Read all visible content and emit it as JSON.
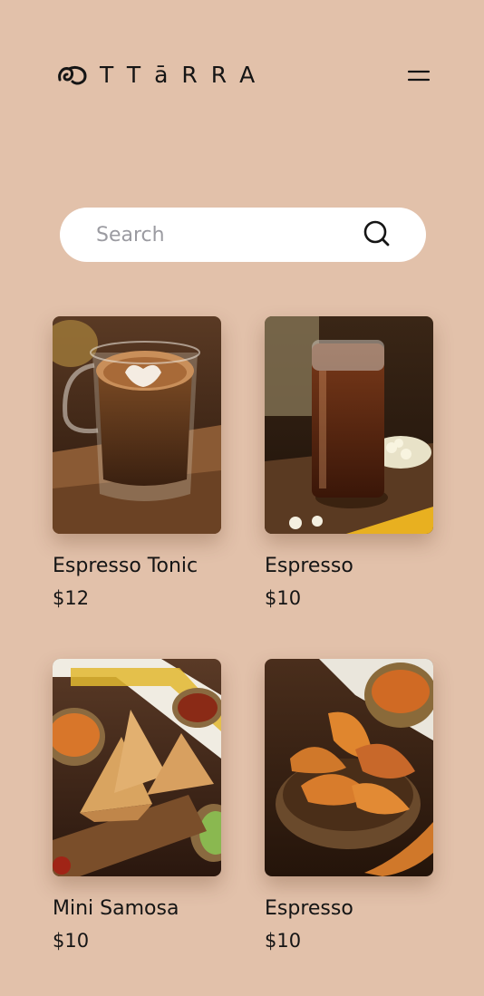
{
  "header": {
    "brand": "TTāRRA",
    "logo_icon": "swirl-glyph-icon",
    "menu_icon": "hamburger-icon"
  },
  "search": {
    "placeholder": "Search",
    "value": "",
    "icon": "search-icon"
  },
  "products": [
    {
      "name": "Espresso Tonic",
      "price": "$12",
      "image": "latte-glass-mug"
    },
    {
      "name": "Espresso",
      "price": "$10",
      "image": "iced-cold-brew-glass"
    },
    {
      "name": "Mini Samosa",
      "price": "$10",
      "image": "samosas-with-chutneys"
    },
    {
      "name": "Espresso",
      "price": "$10",
      "image": "banana-chips-bowl"
    }
  ],
  "colors": {
    "background": "#e2c1aa",
    "text": "#151515",
    "search_bg": "#ffffff",
    "placeholder": "#9b9ba1"
  }
}
